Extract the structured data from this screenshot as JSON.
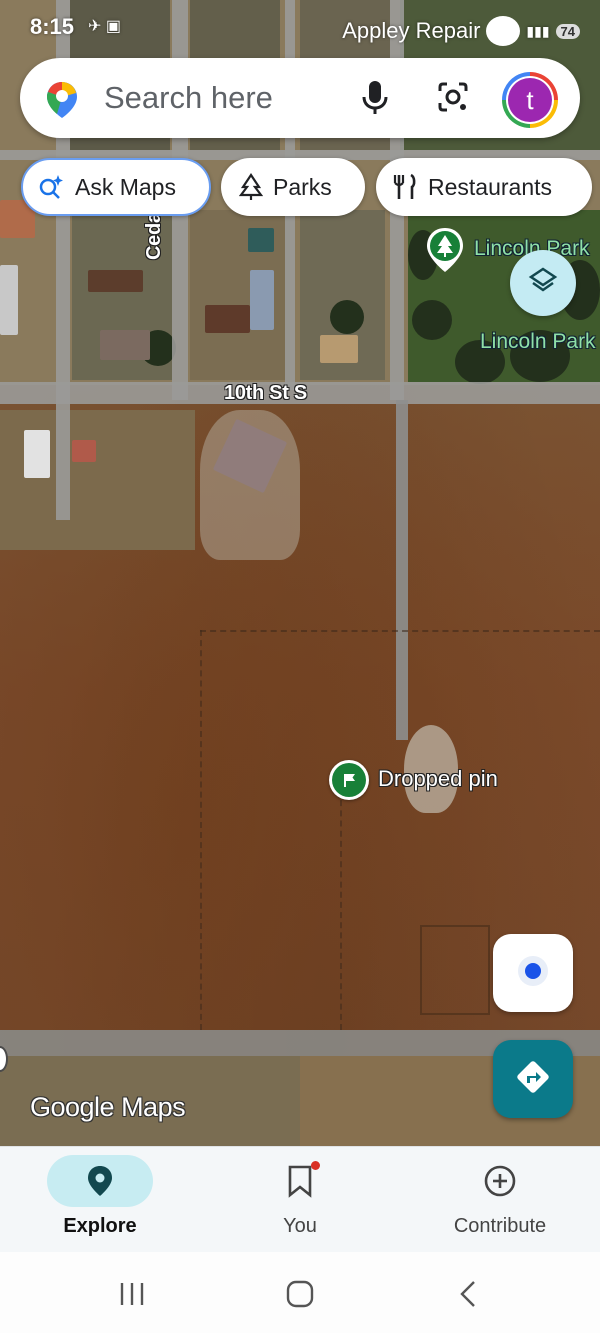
{
  "status_bar": {
    "time": "8:15",
    "notification_text": "Appley Repair",
    "battery": "74"
  },
  "search": {
    "placeholder": "Search here",
    "avatar_letter": "t",
    "avatar_color": "#9c27b0"
  },
  "chips": {
    "ask_maps": "Ask Maps",
    "parks": "Parks",
    "restaurants": "Restaurants"
  },
  "map": {
    "street_cedar": "Cedar Av",
    "street_10th": "10th St S",
    "park_label_top": "Lincoln Park",
    "park_label_bottom": "Lincoln Park",
    "dropped_pin": "Dropped pin",
    "watermark": "Google Maps"
  },
  "bottom_nav": {
    "explore": "Explore",
    "you": "You",
    "contribute": "Contribute"
  },
  "colors": {
    "accent": "#0b7a8a",
    "active_tab_bg": "#c7ecf2",
    "pin_green": "#188038",
    "location_blue": "#1a53e8"
  },
  "icons": [
    "google-maps-pin-icon",
    "mic-icon",
    "lens-camera-icon",
    "sparkle-search-icon",
    "tree-icon",
    "fork-knife-icon",
    "layers-icon",
    "my-location-icon",
    "directions-icon",
    "explore-pin-icon",
    "bookmark-icon",
    "add-circle-icon"
  ]
}
